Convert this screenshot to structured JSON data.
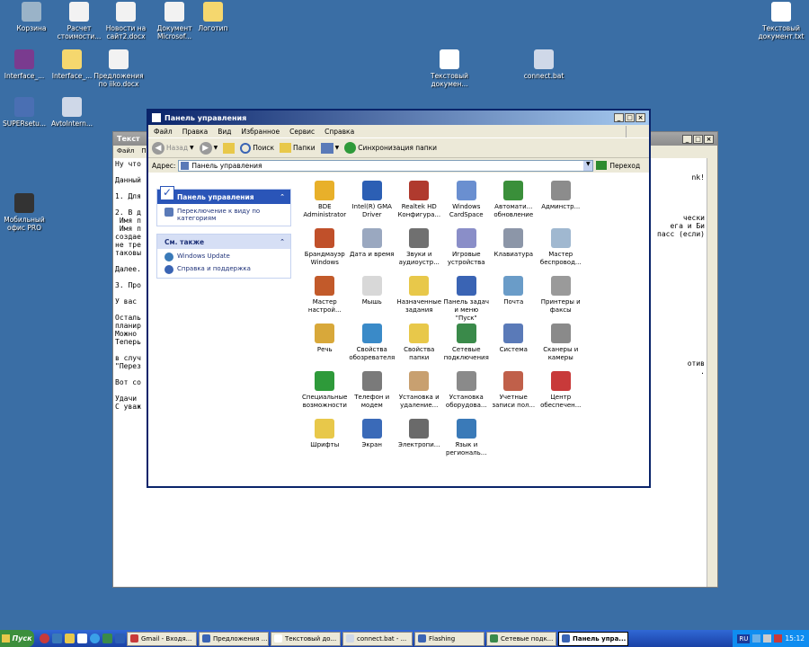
{
  "desktop": {
    "icons": [
      {
        "label": "Корзина",
        "color": "#9ab3c8"
      },
      {
        "label": "Расчет\nстоимости...",
        "color": "#f2f2f2"
      },
      {
        "label": "Новости на\nсайт2.docx",
        "color": "#f2f2f2"
      },
      {
        "label": "Документ\nMicrosof...",
        "color": "#f2f2f2"
      },
      {
        "label": "Логотип",
        "color": "#f5d76e"
      },
      {
        "label": "Текстовый\nдокумент.txt",
        "color": "#ffffff"
      },
      {
        "label": "Interface_...",
        "color": "#7a3b8f"
      },
      {
        "label": "Interface_...",
        "color": "#f5d76e"
      },
      {
        "label": "Предложения\nпо iiko.docx",
        "color": "#f2f2f2"
      },
      {
        "label": "Текстовый\nдокумен...",
        "color": "#ffffff"
      },
      {
        "label": "connect.bat",
        "color": "#cfd8e8"
      },
      {
        "label": "SUPERsetu...",
        "color": "#4a6fb3"
      },
      {
        "label": "AvtoIntern...",
        "color": "#cfd8e8"
      },
      {
        "label": "Мобильный\nофис PRO",
        "color": "#333333"
      }
    ]
  },
  "notepad": {
    "title": "Текст",
    "menu": [
      "Файл",
      "П"
    ],
    "lines": "Ну что\n\nДанный\n\n1. Для\n\n2. В д\n Имя п\n Имя п\nсоздае\nне тре\nтаковы\n\nДалее.\n\n3. Про\n\nУ вас \n\nОсталь\nпланир\nМожно \nТеперь\n\nв случ\n\"Перез\n\nВот со\n\nУдачи \nС уваж",
    "right_lines": "nk!\n\n\n\n\nчески\nега и Би\nпасс (если)\n\n\n\n\n\n\n\n\n\n\n\n\n\n\n\nотив\n."
  },
  "control_panel": {
    "title": "Панель управления",
    "menu": [
      "Файл",
      "Правка",
      "Вид",
      "Избранное",
      "Сервис",
      "Справка"
    ],
    "toolbar": {
      "back": "Назад",
      "search": "Поиск",
      "folders": "Папки",
      "sync": "Синхронизация папки"
    },
    "address": {
      "label": "Адрес:",
      "value": "Панель управления",
      "go": "Переход"
    },
    "taskpane": {
      "main_header": "Панель управления",
      "switch_view": "Переключение к виду по категориям",
      "see_also_header": "См. также",
      "links": [
        "Windows Update",
        "Справка и поддержка"
      ]
    },
    "icons": [
      {
        "label": "BDE\nAdministrator",
        "color": "#e8b02a"
      },
      {
        "label": "Intel(R) GMA\nDriver",
        "color": "#2c5fb4"
      },
      {
        "label": "Realtek HD\nКонфигура...",
        "color": "#b03a2e"
      },
      {
        "label": "Windows\nCardSpace",
        "color": "#6a8fd0"
      },
      {
        "label": "Автомати...\nобновление",
        "color": "#3a8f3a"
      },
      {
        "label": "Админстр...",
        "color": "#8c8c8c"
      },
      {
        "label": "Брандмауэр\nWindows",
        "color": "#c0502a"
      },
      {
        "label": "Дата и время",
        "color": "#9aa8c0"
      },
      {
        "label": "Звуки и\nаудиоустр...",
        "color": "#707070"
      },
      {
        "label": "Игровые\nустройства",
        "color": "#8a8ec8"
      },
      {
        "label": "Клавиатура",
        "color": "#8c96a8"
      },
      {
        "label": "Мастер\nбеспровод...",
        "color": "#a0b8d0"
      },
      {
        "label": "Мастер\nнастрой...",
        "color": "#c25a2a"
      },
      {
        "label": "Мышь",
        "color": "#d8d8d8"
      },
      {
        "label": "Назначенные\nзадания",
        "color": "#e8c84a"
      },
      {
        "label": "Панель задач\nи меню \"Пуск\"",
        "color": "#3a64b4"
      },
      {
        "label": "Почта",
        "color": "#6a9cc8"
      },
      {
        "label": "Принтеры и\nфаксы",
        "color": "#9a9a9a"
      },
      {
        "label": "Речь",
        "color": "#d8a83a"
      },
      {
        "label": "Свойства\nобозревателя",
        "color": "#3a8ac8"
      },
      {
        "label": "Свойства\nпапки",
        "color": "#e8c84a"
      },
      {
        "label": "Сетевые\nподключения",
        "color": "#3a8a4a"
      },
      {
        "label": "Система",
        "color": "#5a7ab8"
      },
      {
        "label": "Сканеры и\nкамеры",
        "color": "#8a8a8a"
      },
      {
        "label": "Специальные\nвозможности",
        "color": "#2e9a3a"
      },
      {
        "label": "Телефон и\nмодем",
        "color": "#7a7a7a"
      },
      {
        "label": "Установка и\nудаление...",
        "color": "#c8a070"
      },
      {
        "label": "Установка\nоборудова...",
        "color": "#8a8a8a"
      },
      {
        "label": "Учетные\nзаписи пол...",
        "color": "#c0604a"
      },
      {
        "label": "Центр\nобеспечен...",
        "color": "#c83a3a"
      },
      {
        "label": "Шрифты",
        "color": "#e8c84a"
      },
      {
        "label": "Экран",
        "color": "#3a6ab8"
      },
      {
        "label": "Электропи...",
        "color": "#6a6a6a"
      },
      {
        "label": "Язык и\nрегиональ...",
        "color": "#3a7ab8"
      }
    ]
  },
  "taskbar": {
    "start": "Пуск",
    "tasks": [
      {
        "label": "Gmail - Входя...",
        "color": "#c83a3a"
      },
      {
        "label": "Предложения ...",
        "color": "#3a64b4"
      },
      {
        "label": "Текстовый до...",
        "color": "#ffffff"
      },
      {
        "label": "connect.bat - ...",
        "color": "#cfd8e8"
      },
      {
        "label": "Flashing",
        "color": "#3a64b4"
      },
      {
        "label": "Сетевые подк...",
        "color": "#3a8a4a"
      },
      {
        "label": "Панель упра...",
        "color": "#3a64b4"
      }
    ],
    "lang": "RU",
    "time": "15:12"
  }
}
